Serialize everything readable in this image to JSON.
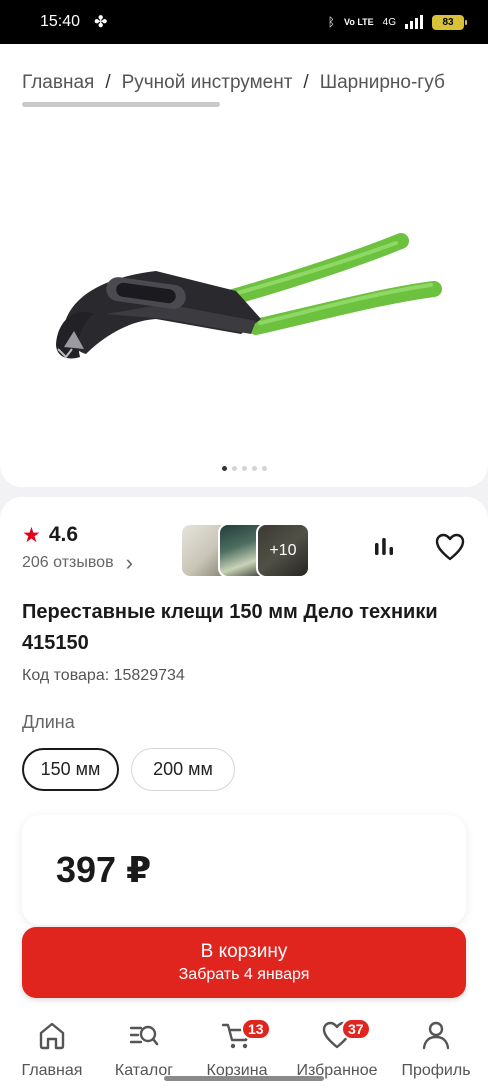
{
  "status_bar": {
    "time": "15:40",
    "battery": "83",
    "network": "4G",
    "volte": "Vo LTE"
  },
  "breadcrumb": {
    "items": [
      "Главная",
      "Ручной инструмент",
      "Шарнирно-губ"
    ],
    "separator": "/"
  },
  "gallery": {
    "image_count": 5,
    "active_index": 0,
    "thumbnail_more": "+10"
  },
  "rating": {
    "value": "4.6",
    "reviews": "206 отзывов"
  },
  "product": {
    "title": "Переставные клещи 150 мм Дело техники 415150",
    "sku": "Код товара: 15829734",
    "option_label": "Длина",
    "options": [
      "150 мм",
      "200 мм"
    ],
    "selected_option": "150 мм",
    "price": "397 ₽"
  },
  "cart_button": {
    "label": "В корзину",
    "delivery": "Забрать 4 января"
  },
  "tabs": [
    {
      "label": "Главная",
      "icon": "home-icon"
    },
    {
      "label": "Каталог",
      "icon": "catalog-icon"
    },
    {
      "label": "Корзина",
      "icon": "cart-icon",
      "badge": "13"
    },
    {
      "label": "Избранное",
      "icon": "heart-icon",
      "badge": "37"
    },
    {
      "label": "Профиль",
      "icon": "profile-icon"
    }
  ],
  "colors": {
    "accent": "#e0251f",
    "handle_green": "#6cc13e",
    "text": "#1a1a1a"
  }
}
